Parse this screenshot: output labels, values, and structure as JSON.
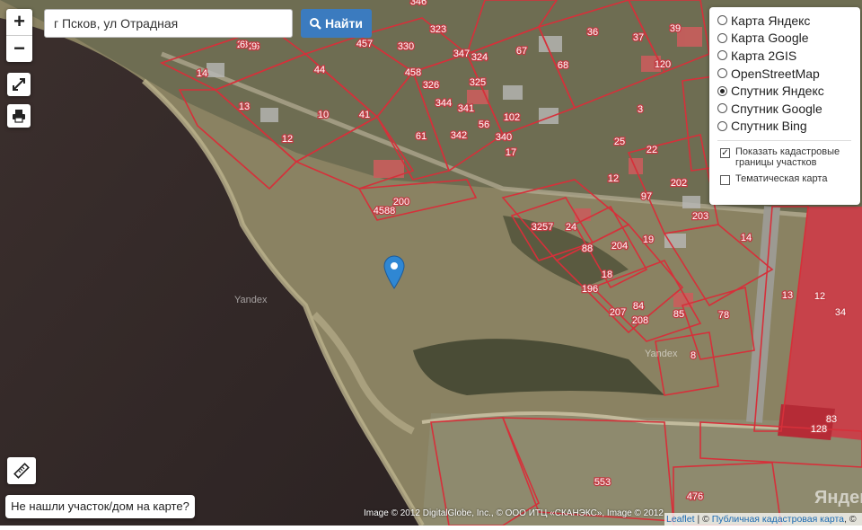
{
  "search": {
    "value": "г Псков, ул Отрадная",
    "button_label": "Найти"
  },
  "zoom": {
    "in_label": "+",
    "out_label": "−"
  },
  "layers": {
    "options": [
      {
        "label": "Карта Яндекс",
        "selected": false
      },
      {
        "label": "Карта Google",
        "selected": false
      },
      {
        "label": "Карта 2GIS",
        "selected": false
      },
      {
        "label": "OpenStreetMap",
        "selected": false
      },
      {
        "label": "Спутник Яндекс",
        "selected": true
      },
      {
        "label": "Спутник Google",
        "selected": false
      },
      {
        "label": "Спутник Bing",
        "selected": false
      }
    ],
    "cadastral_label": "Показать кадастровые границы участков",
    "cadastral_checked": true,
    "thematic_label": "Тематическая карта",
    "thematic_checked": false
  },
  "not_found_label": "Не нашли участок/дом на карте?",
  "imagery_credit": "Image © 2012 DigitalGlobe, Inc., © ООО ИТЦ «СКАНЭКС», Image © 2012",
  "attribution": {
    "leaflet": "Leaflet",
    "separator": " | © ",
    "link": "Публичная кадастровая карта",
    "tail": ", ©"
  },
  "watermark": "Yandex",
  "watermark_big": "Яндекс",
  "parcel_labels": [
    "26",
    "28",
    "457",
    "330",
    "346",
    "323",
    "36",
    "37",
    "39",
    "14",
    "44",
    "347",
    "324",
    "67",
    "68",
    "120",
    "458",
    "326",
    "325",
    "13",
    "10",
    "41",
    "344",
    "341",
    "61",
    "12",
    "342",
    "56",
    "340",
    "102",
    "3",
    "25",
    "22",
    "202",
    "203",
    "200",
    "4588",
    "14",
    "24",
    "88",
    "204",
    "19",
    "18",
    "196",
    "207",
    "208",
    "84",
    "85",
    "78",
    "8",
    "13",
    "12",
    "34",
    "83",
    "128",
    "553",
    "476",
    "3257",
    "12",
    "97",
    "17",
    "9",
    "6"
  ]
}
